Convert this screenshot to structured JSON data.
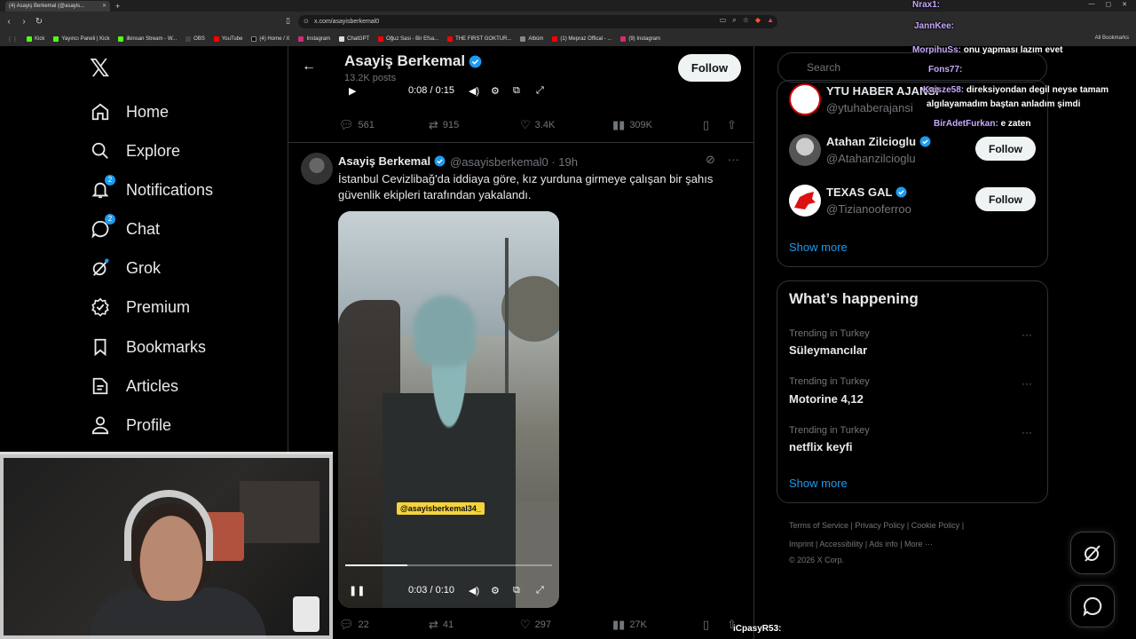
{
  "browser": {
    "tab_title": "(4) Asayiş Berkemal (@asayis...",
    "url": "x.com/asayisberkemal0",
    "bookmarks": [
      "Kick",
      "Yayıncı Paneli | Kick",
      "ilkinsan Stream - W...",
      "OBS",
      "YouTube",
      "(4) Home / X",
      "Instagram",
      "ChatGPT",
      "Oğuz Sasi - Bir Efsa...",
      "THE FIRST GOKTUR...",
      "Albüm",
      "(1) Mepraz Offical - ...",
      "(9) Instagram"
    ],
    "all_bookmarks": "All Bookmarks"
  },
  "nav": {
    "items": [
      {
        "label": "Home",
        "icon": "home-icon"
      },
      {
        "label": "Explore",
        "icon": "search-icon"
      },
      {
        "label": "Notifications",
        "icon": "bell-icon",
        "badge": "2"
      },
      {
        "label": "Chat",
        "icon": "chat-icon",
        "badge": "2"
      },
      {
        "label": "Grok",
        "icon": "grok-icon"
      },
      {
        "label": "Premium",
        "icon": "premium-icon"
      },
      {
        "label": "Bookmarks",
        "icon": "bookmark-icon"
      },
      {
        "label": "Articles",
        "icon": "articles-icon"
      },
      {
        "label": "Profile",
        "icon": "profile-icon"
      }
    ]
  },
  "header": {
    "name": "Asayiş Berkemal",
    "posts": "13.2K posts",
    "follow": "Follow"
  },
  "prev_post": {
    "video_time": "0:08 / 0:15",
    "replies": "561",
    "reposts": "915",
    "likes": "3.4K",
    "views": "309K"
  },
  "post": {
    "name": "Asayiş Berkemal",
    "handle": "@asayisberkemal0 · 19h",
    "text": "İstanbul Cevizlibağ'da iddiaya göre, kız yurduna girmeye çalışan bir şahıs güvenlik ekipleri tarafından yakalandı.",
    "watermark": "@asayisberkemal34_",
    "video_time": "0:03 / 0:10",
    "progress": 0.3,
    "replies": "22",
    "reposts": "41",
    "likes": "297",
    "views": "27K"
  },
  "right": {
    "search_placeholder": "Search",
    "who": [
      {
        "name": "YTU HABER AJANSI",
        "handle": "@ytuhaberajansi",
        "follow": "Follow",
        "verified": false
      },
      {
        "name": "Atahan Zilcioglu",
        "handle": "@Atahanzilcioglu",
        "follow": "Follow",
        "verified": true
      },
      {
        "name": "TEXAS GAL",
        "handle": "@Tizianooferroo",
        "follow": "Follow",
        "verified": true
      }
    ],
    "show_more": "Show more",
    "whats_happening": "What’s happening",
    "trends": [
      {
        "context": "Trending in Turkey",
        "name": "Süleymancılar"
      },
      {
        "context": "Trending in Turkey",
        "name": "Motorine 4,12"
      },
      {
        "context": "Trending in Turkey",
        "name": "netflix keyfi"
      }
    ],
    "show_more_2": "Show more",
    "footer": {
      "line1": "Terms of Service  |  Privacy Policy  |  Cookie Policy  |",
      "line2": "Imprint  |  Accessibility  |  Ads info  |  More ···",
      "line3": "© 2026 X Corp."
    }
  },
  "stream_chat": [
    {
      "user": "Nrax1:",
      "msg": ""
    },
    {
      "user": "JannKee:",
      "msg": ""
    },
    {
      "user": "MorpihuSs:",
      "msg": "onu yapması lazım evet"
    },
    {
      "user": "Fons77:",
      "msg": ""
    },
    {
      "user": "Kaisze58:",
      "msg": "direksiyondan degil neyse tamam"
    },
    {
      "user": "",
      "msg": "algılayamadım baştan anladım şimdi"
    },
    {
      "user": "BirAdetFurkan:",
      "msg": "e zaten"
    },
    {
      "user": "iCpasyR53:",
      "msg": ""
    }
  ],
  "colors": {
    "accent": "#1d9bf0",
    "background": "#000000",
    "border": "#2f3336",
    "text": "#e7e9ea",
    "muted": "#71767b"
  }
}
